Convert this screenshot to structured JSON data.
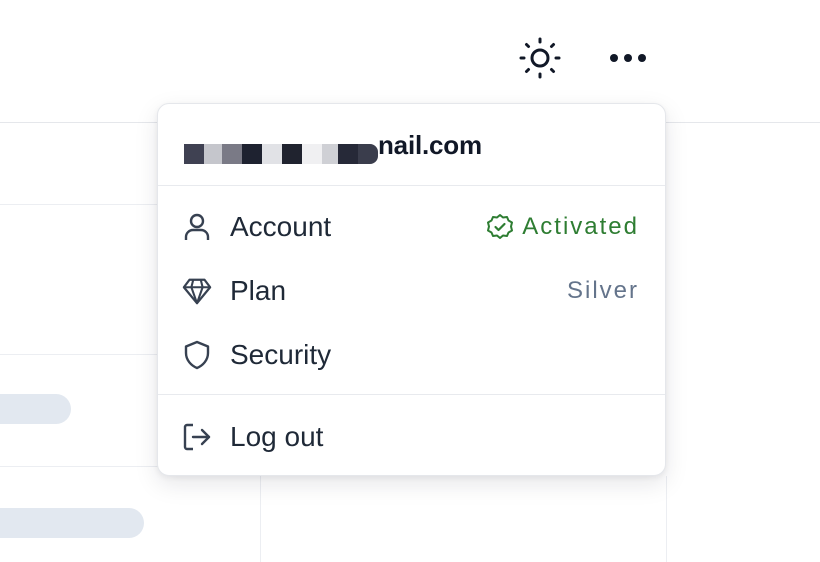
{
  "header": {
    "theme_icon": "sun-icon",
    "more_icon": "more-horizontal-icon"
  },
  "user_menu": {
    "email_visible_suffix": "nail.com",
    "items": [
      {
        "label": "Account",
        "icon": "user-icon",
        "status": "Activated",
        "status_icon": "badge-check-icon",
        "status_color": "#2e7d32"
      },
      {
        "label": "Plan",
        "icon": "diamond-icon",
        "status": "Silver",
        "status_color": "#64748b"
      },
      {
        "label": "Security",
        "icon": "shield-icon"
      }
    ],
    "logout": {
      "label": "Log out",
      "icon": "log-out-icon"
    }
  },
  "colors": {
    "text_primary": "#1f2937",
    "accent_success": "#2e7d32",
    "muted": "#64748b",
    "skeleton": "#e2e8f0"
  }
}
